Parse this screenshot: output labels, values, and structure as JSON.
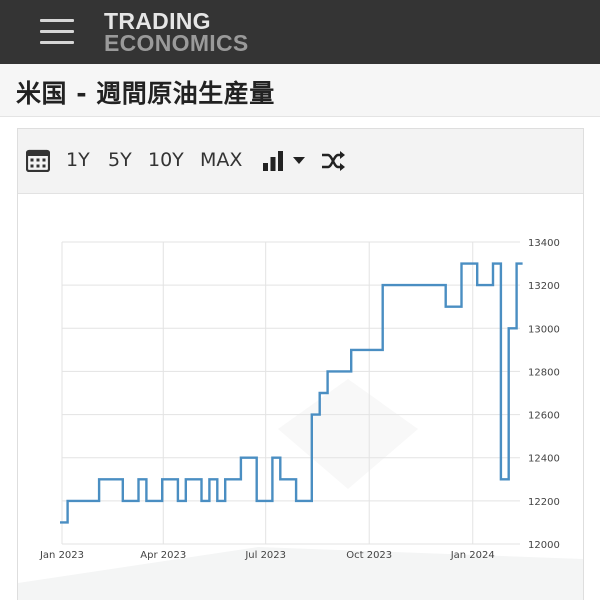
{
  "header": {
    "logo_line1": "TRADING",
    "logo_line2": "ECONOMICS",
    "menu_icon": "hamburger-menu-icon"
  },
  "page": {
    "title": "米国 - 週間原油生産量"
  },
  "toolbar": {
    "calendar_icon": "calendar-icon",
    "range_1y": "1Y",
    "range_5y": "5Y",
    "range_10y": "10Y",
    "range_max": "MAX",
    "chart_type_icon": "bar-chart-icon",
    "dropdown_icon": "caret-down-icon",
    "compare_icon": "shuffle-icon"
  },
  "colors": {
    "topbar": "#343434",
    "line": "#4a8ec2",
    "grid": "#e3e3e3"
  },
  "chart_data": {
    "type": "line",
    "title": "",
    "xlabel": "",
    "ylabel": "",
    "x": [
      "2022-12-30",
      "2023-01-06",
      "2023-01-13",
      "2023-01-20",
      "2023-01-27",
      "2023-02-03",
      "2023-02-10",
      "2023-02-17",
      "2023-02-24",
      "2023-03-03",
      "2023-03-10",
      "2023-03-17",
      "2023-03-24",
      "2023-03-31",
      "2023-04-07",
      "2023-04-14",
      "2023-04-21",
      "2023-04-28",
      "2023-05-05",
      "2023-05-12",
      "2023-05-19",
      "2023-05-26",
      "2023-06-02",
      "2023-06-09",
      "2023-06-16",
      "2023-06-23",
      "2023-06-30",
      "2023-07-07",
      "2023-07-14",
      "2023-07-21",
      "2023-07-28",
      "2023-08-04",
      "2023-08-11",
      "2023-08-18",
      "2023-08-25",
      "2023-09-01",
      "2023-09-08",
      "2023-09-15",
      "2023-09-22",
      "2023-09-29",
      "2023-10-06",
      "2023-10-13",
      "2023-10-20",
      "2023-10-27",
      "2023-11-03",
      "2023-11-10",
      "2023-11-17",
      "2023-11-24",
      "2023-12-01",
      "2023-12-08",
      "2023-12-15",
      "2023-12-22",
      "2023-12-29",
      "2024-01-05",
      "2024-01-12",
      "2024-01-19",
      "2024-01-26",
      "2024-02-02",
      "2024-02-09"
    ],
    "series": [
      {
        "values": [
          12100,
          12200,
          12200,
          12200,
          12200,
          12300,
          12300,
          12300,
          12200,
          12200,
          12300,
          12200,
          12200,
          12300,
          12300,
          12200,
          12300,
          12300,
          12200,
          12300,
          12200,
          12300,
          12300,
          12400,
          12400,
          12200,
          12200,
          12400,
          12300,
          12300,
          12200,
          12200,
          12600,
          12700,
          12800,
          12800,
          12800,
          12900,
          12900,
          12900,
          12900,
          13200,
          13200,
          13200,
          13200,
          13200,
          13200,
          13200,
          13200,
          13100,
          13100,
          13300,
          13300,
          13200,
          13200,
          13300,
          12300,
          13000,
          13300
        ]
      }
    ],
    "ylim": [
      12000,
      13400
    ],
    "y_ticks": [
      "13400",
      "13200",
      "13000",
      "12800",
      "12600",
      "12400",
      "12200",
      "12000"
    ],
    "x_ticks": [
      {
        "label": "Jan 2023",
        "date": "2023-01-01"
      },
      {
        "label": "Apr 2023",
        "date": "2023-04-01"
      },
      {
        "label": "Jul 2023",
        "date": "2023-07-01"
      },
      {
        "label": "Oct 2023",
        "date": "2023-10-01"
      },
      {
        "label": "Jan 2024",
        "date": "2024-01-01"
      }
    ],
    "x_range": [
      "2023-01-01",
      "2024-02-12"
    ],
    "grid": true,
    "y_axis_side": "right",
    "step": true
  }
}
